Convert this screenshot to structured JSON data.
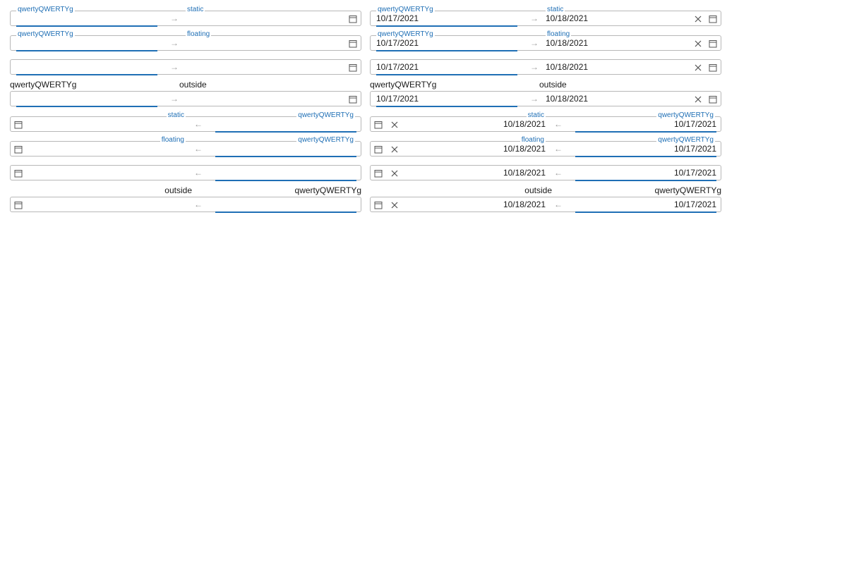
{
  "labels": {
    "start": "qwertyQWERTYg",
    "end_static": "static",
    "end_floating": "floating",
    "outside": "outside"
  },
  "values": {
    "start_date": "10/17/2021",
    "end_date": "10/18/2021"
  },
  "separators": {
    "ltr": "→",
    "rtl": "←"
  },
  "icons": {
    "calendar": "calendar-icon",
    "clear": "clear-icon"
  },
  "colors": {
    "accent": "#1f6fb5",
    "border": "#b8b8b8",
    "separator": "#9a9a9a"
  }
}
